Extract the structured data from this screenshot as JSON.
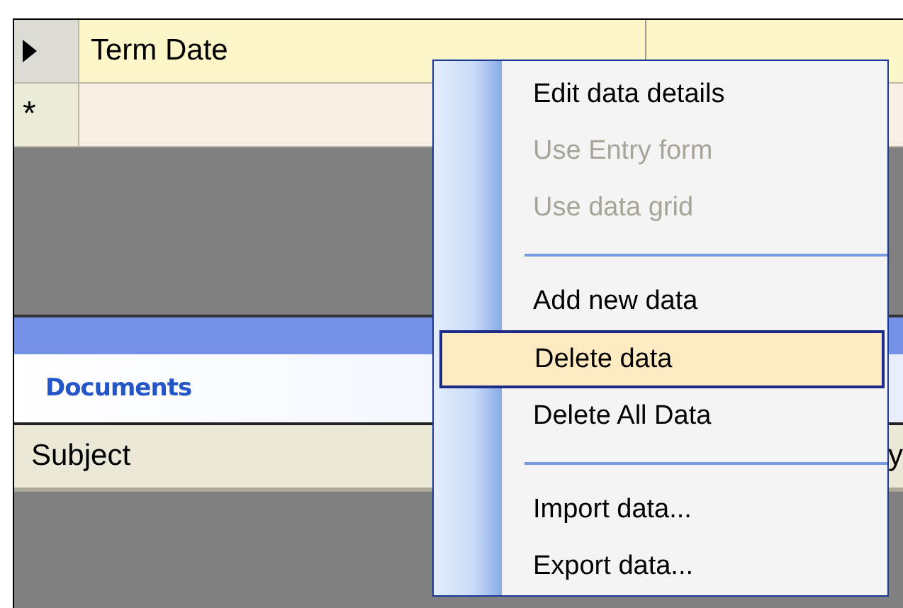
{
  "grid": {
    "rows": [
      {
        "kind": "current",
        "cell": "Term Date"
      },
      {
        "kind": "new",
        "marker": "*"
      }
    ]
  },
  "panel": {
    "title": "Documents",
    "columns": [
      "Subject",
      "y"
    ]
  },
  "context_menu": {
    "items": [
      {
        "kind": "item",
        "label": "Edit data details",
        "disabled": false,
        "selected": false
      },
      {
        "kind": "item",
        "label": "Use Entry form",
        "disabled": true,
        "selected": false
      },
      {
        "kind": "item",
        "label": "Use data grid",
        "disabled": true,
        "selected": false
      },
      {
        "kind": "separator"
      },
      {
        "kind": "item",
        "label": "Add new data",
        "disabled": false,
        "selected": false
      },
      {
        "kind": "item",
        "label": "Delete data",
        "disabled": false,
        "selected": true
      },
      {
        "kind": "item",
        "label": "Delete All Data",
        "disabled": false,
        "selected": false
      },
      {
        "kind": "separator"
      },
      {
        "kind": "item",
        "label": "Import data...",
        "disabled": false,
        "selected": false
      },
      {
        "kind": "item",
        "label": "Export data...",
        "disabled": false,
        "selected": false
      }
    ]
  }
}
